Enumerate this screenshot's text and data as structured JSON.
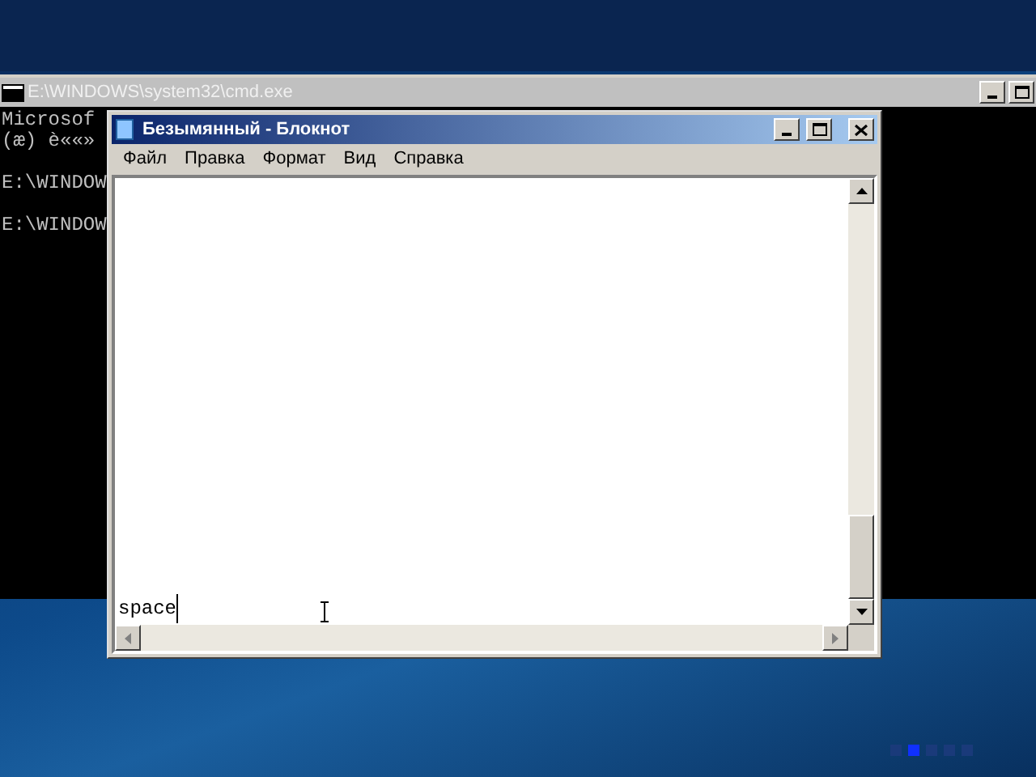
{
  "console_window": {
    "title": "E:\\WINDOWS\\system32\\cmd.exe",
    "blocks": [
      [
        "Microsof",
        "(æ) è««»"
      ],
      [
        "E:\\WINDOW"
      ],
      [
        "E:\\WINDOW"
      ]
    ]
  },
  "notepad_window": {
    "title": "Безымянный - Блокнот",
    "menu": [
      "Файл",
      "Правка",
      "Формат",
      "Вид",
      "Справка"
    ],
    "text": "space"
  },
  "page_dots": [
    {
      "selected": false
    },
    {
      "selected": true
    },
    {
      "selected": false
    },
    {
      "selected": false
    },
    {
      "selected": false
    }
  ]
}
